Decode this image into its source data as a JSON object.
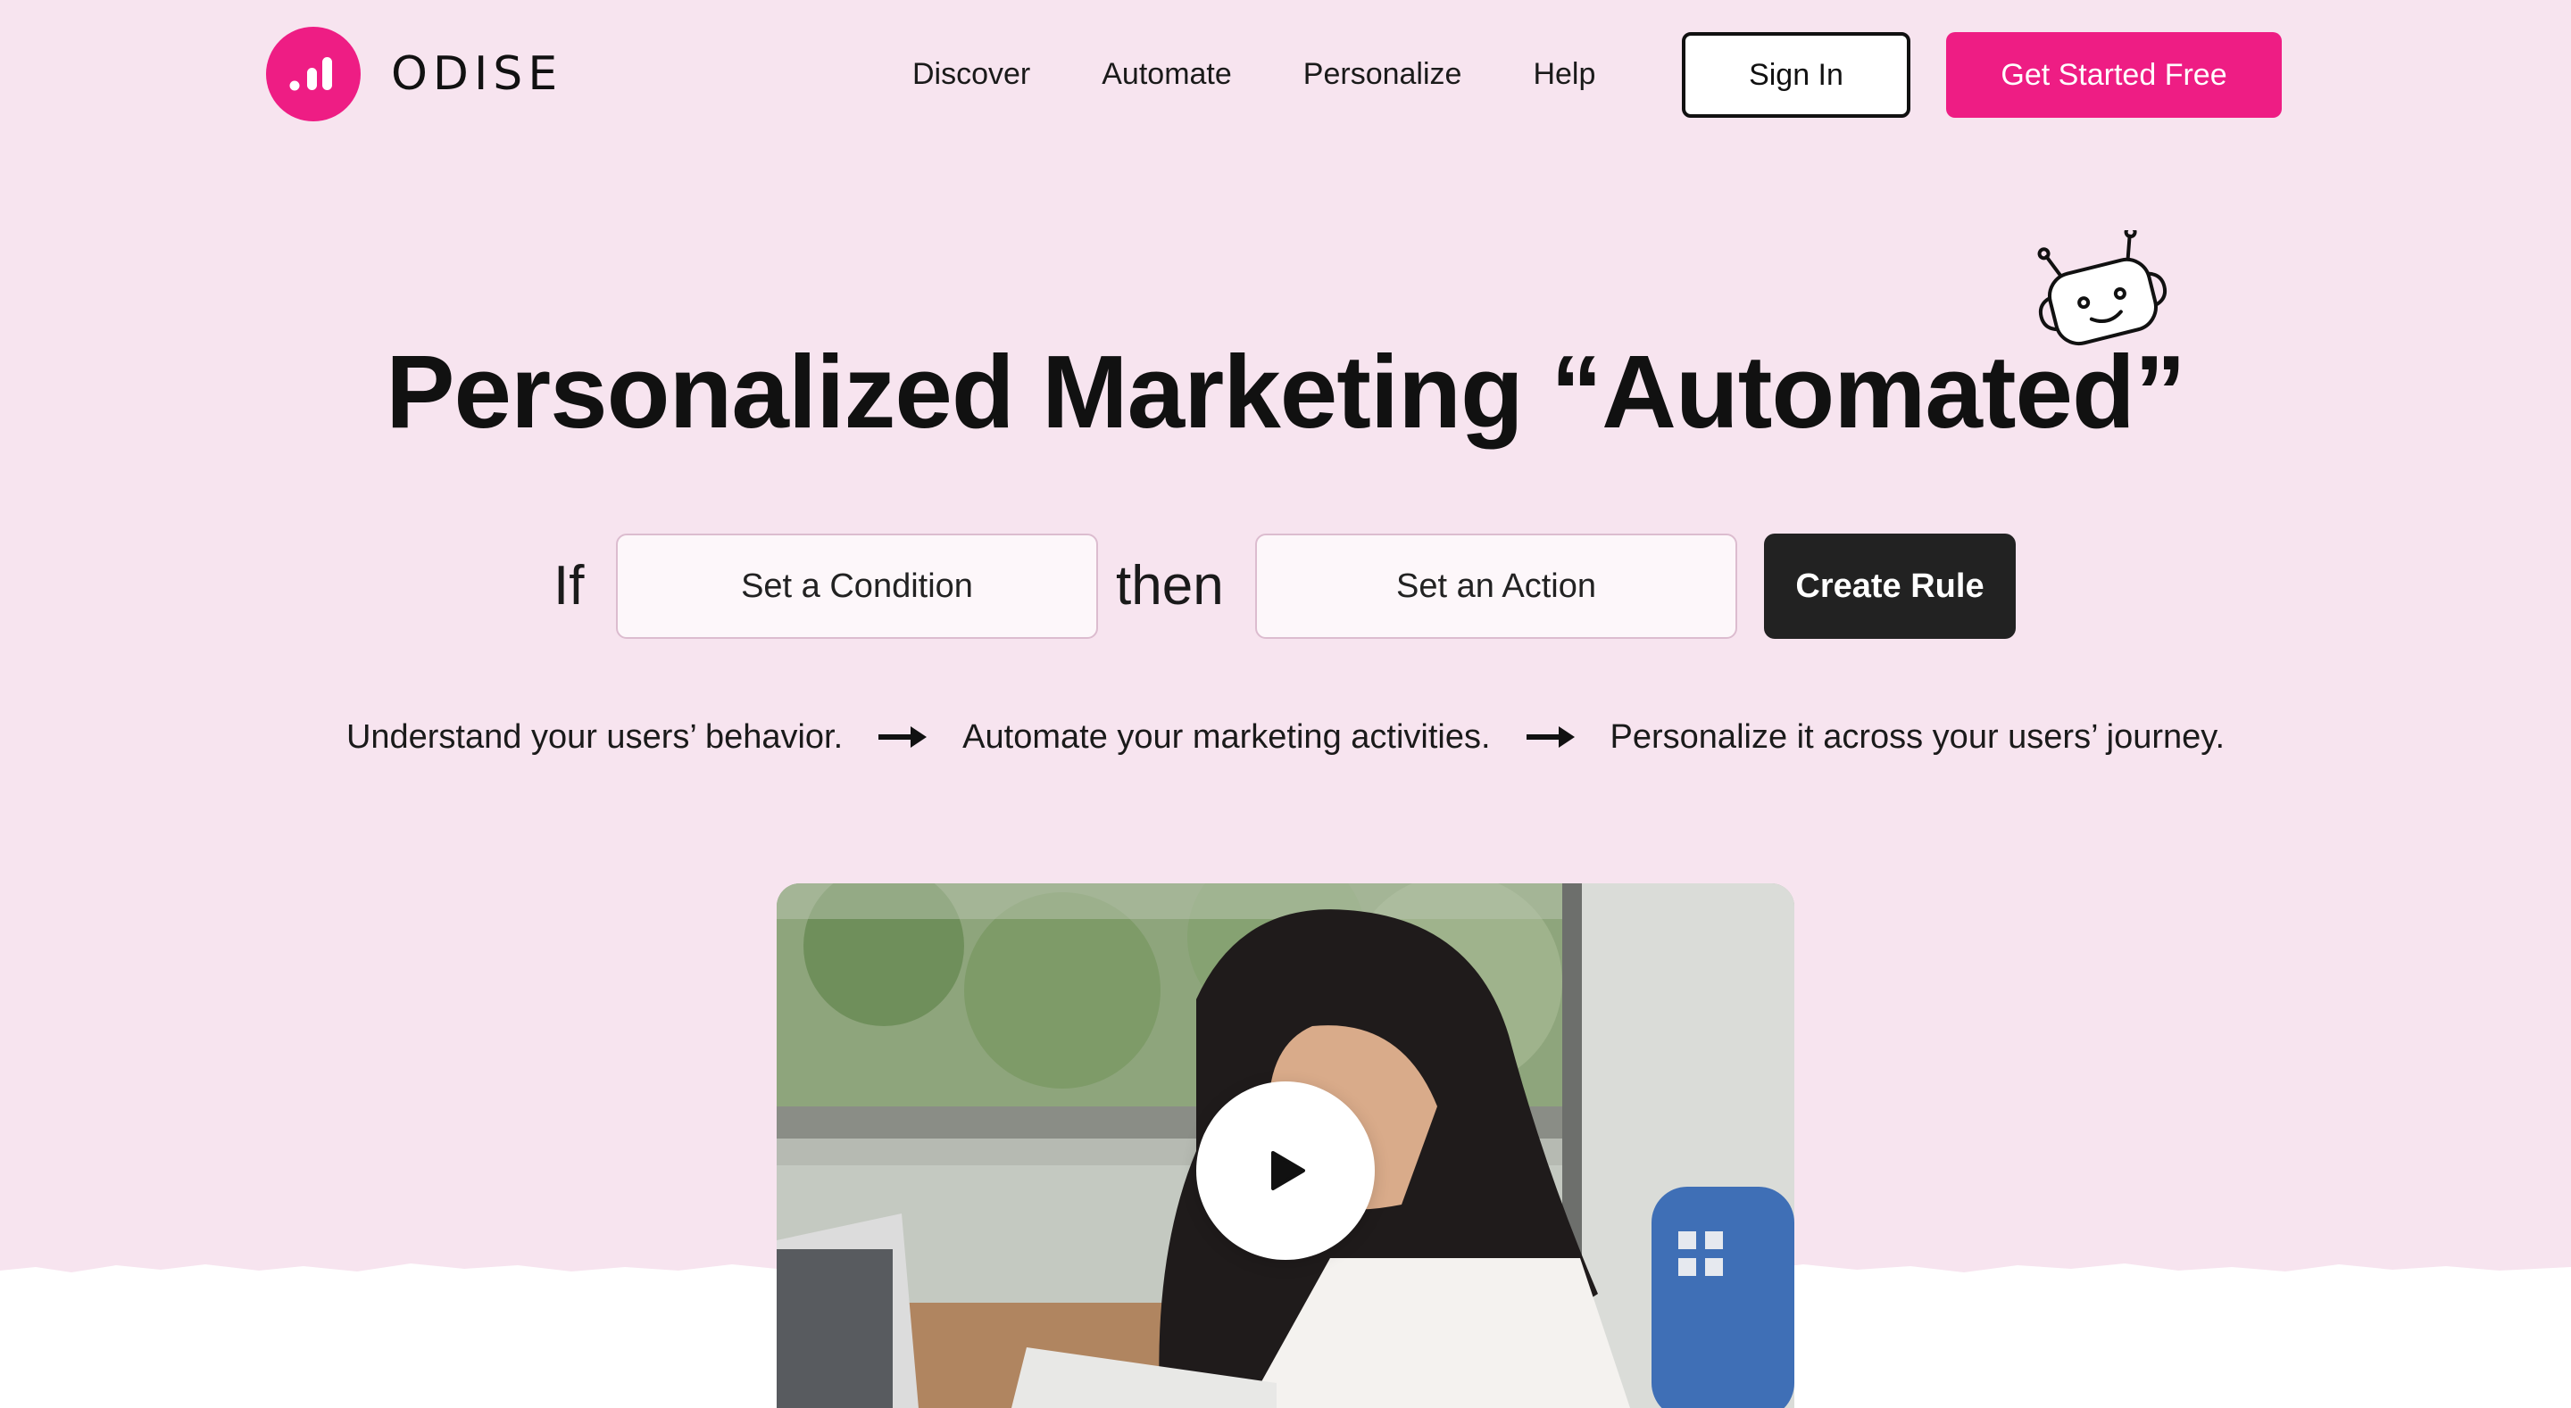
{
  "brand": {
    "name": "ODISE",
    "accent": "#ee1d84",
    "logo_icon": "bar-chart-icon"
  },
  "nav": {
    "items": [
      {
        "label": "Discover"
      },
      {
        "label": "Automate"
      },
      {
        "label": "Personalize"
      },
      {
        "label": "Help"
      }
    ],
    "sign_in": "Sign In",
    "get_started": "Get Started Free"
  },
  "hero": {
    "title": "Personalized Marketing “Automated”",
    "mascot_icon": "robot-icon"
  },
  "rule": {
    "if_label": "If",
    "condition_placeholder": "Set a Condition",
    "then_label": "then",
    "action_placeholder": "Set an Action",
    "create_label": "Create Rule"
  },
  "steps": [
    "Understand your users’ behavior.",
    "Automate your marketing activities.",
    "Personalize it across your users’ journey."
  ],
  "video": {
    "play_icon": "play-icon"
  },
  "colors": {
    "background": "#f7e4ef",
    "dark_button": "#222222"
  }
}
